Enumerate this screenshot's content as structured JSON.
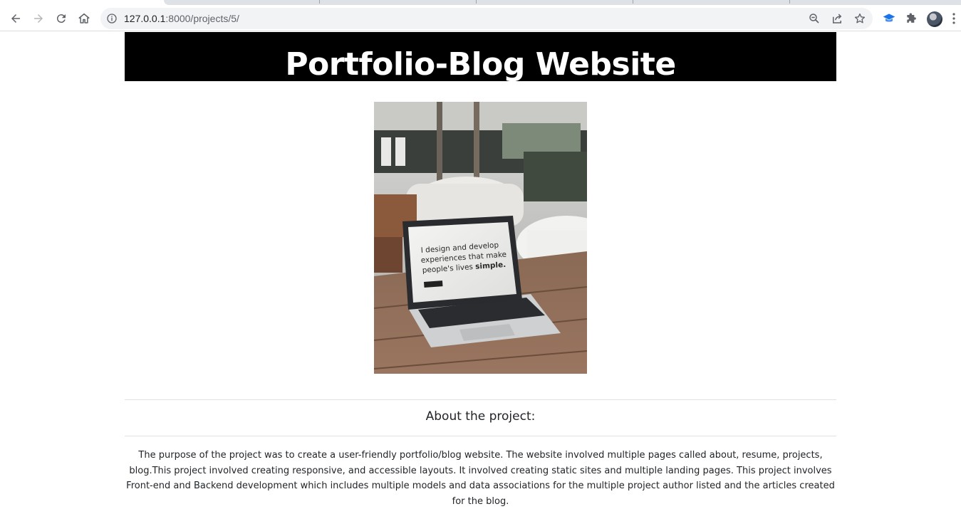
{
  "browser": {
    "url_host": "127.0.0.1",
    "url_path": ":8000/projects/5/"
  },
  "icons": {
    "back": "back-arrow-icon",
    "forward": "forward-arrow-icon",
    "reload": "reload-icon",
    "home": "home-icon",
    "site_info": "info-icon",
    "zoom": "zoom-out-icon",
    "share": "share-icon",
    "bookmark": "star-icon",
    "extension_1": "graduation-cap-icon",
    "extensions": "puzzle-icon",
    "profile": "avatar",
    "menu": "kebab-menu-icon"
  },
  "page": {
    "title": "Portfolio-Blog Website",
    "about_heading": "About the project:",
    "about_text": "The purpose of the project was to create a user-friendly portfolio/blog website. The website involved multiple pages called about, resume, projects, blog.This project involved creating responsive, and accessible layouts. It involved creating static sites and multiple landing pages. This project involves Front-end and Backend development which includes multiple models and data associations for the multiple project author listed and the articles created for the blog.",
    "image_screen_text": "I design and develop experiences that make people's lives simple."
  },
  "colors": {
    "banner_bg": "#000000",
    "banner_text": "#ffffff",
    "body_text": "#212529"
  }
}
